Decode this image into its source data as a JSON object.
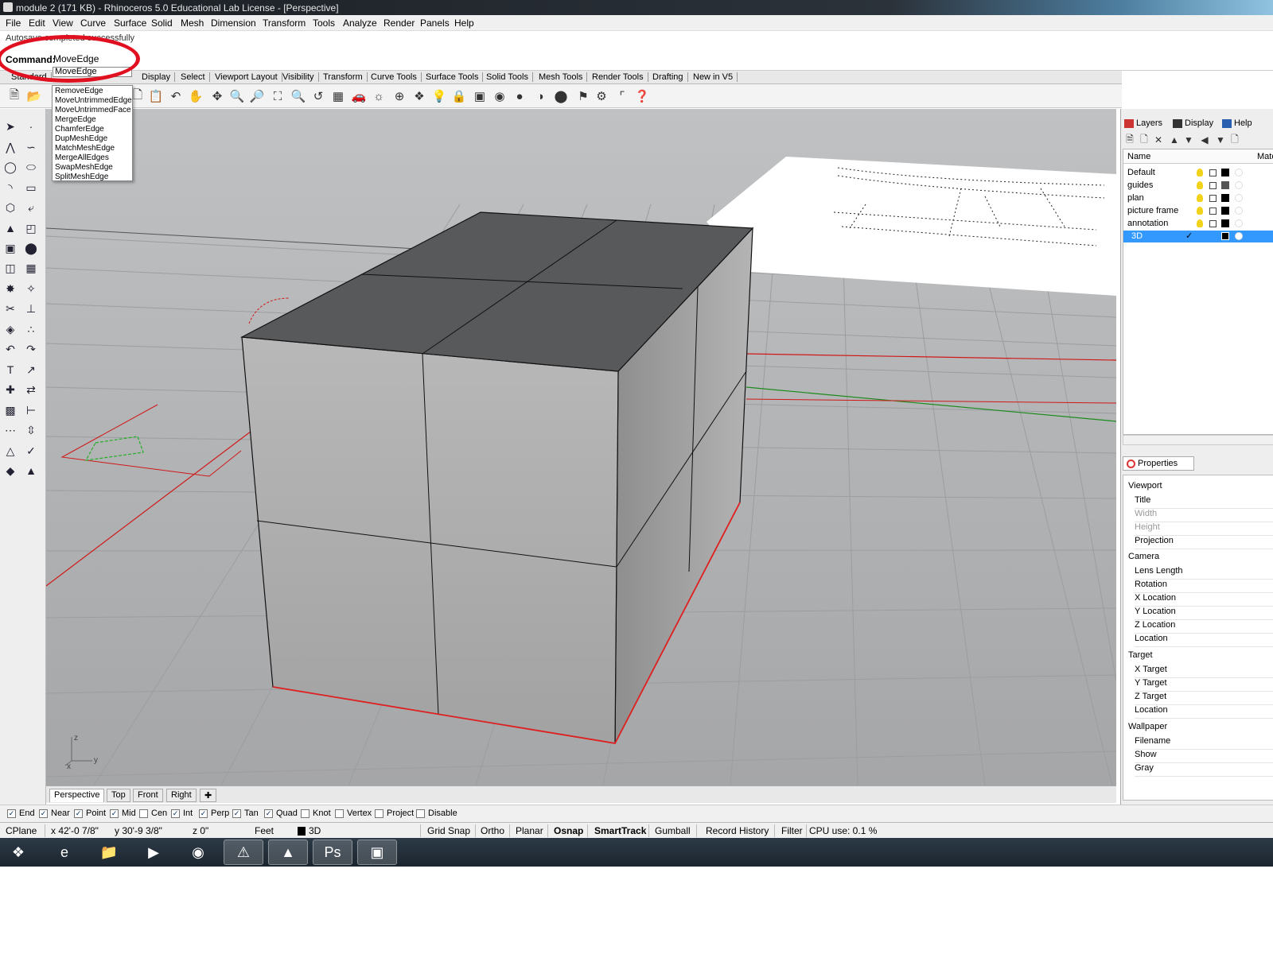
{
  "window": {
    "title": "module 2 (171 KB) - Rhinoceros 5.0 Educational Lab License - [Perspective]"
  },
  "menu": [
    "File",
    "Edit",
    "View",
    "Curve",
    "Surface",
    "Solid",
    "Mesh",
    "Dimension",
    "Transform",
    "Tools",
    "Analyze",
    "Render",
    "Panels",
    "Help"
  ],
  "command": {
    "history": "Autosave completed successfully",
    "label": "Command:",
    "value": "MoveEdge"
  },
  "toolbar_tabs": [
    "Standard",
    "Display",
    "Select",
    "Viewport Layout",
    "Visibility",
    "Transform",
    "Curve Tools",
    "Surface Tools",
    "Solid Tools",
    "Mesh Tools",
    "Render Tools",
    "Drafting",
    "New in V5"
  ],
  "autocomplete": {
    "current": "MoveEdge",
    "items": [
      "RemoveEdge",
      "MoveUntrimmedEdge",
      "MoveUntrimmedFace",
      "MergeEdge",
      "ChamferEdge",
      "DupMeshEdge",
      "MatchMeshEdge",
      "MergeAllEdges",
      "SwapMeshEdge",
      "SplitMeshEdge"
    ]
  },
  "viewport": {
    "name": "Perspective",
    "axis_labels": {
      "z": "z",
      "y": "y",
      "x": "x"
    }
  },
  "viewport_tabs": [
    "Perspective",
    "Top",
    "Front",
    "Right"
  ],
  "osnaps": [
    {
      "label": "End",
      "checked": true
    },
    {
      "label": "Near",
      "checked": true
    },
    {
      "label": "Point",
      "checked": true
    },
    {
      "label": "Mid",
      "checked": true
    },
    {
      "label": "Cen",
      "checked": false
    },
    {
      "label": "Int",
      "checked": true
    },
    {
      "label": "Perp",
      "checked": true
    },
    {
      "label": "Tan",
      "checked": true
    },
    {
      "label": "Quad",
      "checked": true
    },
    {
      "label": "Knot",
      "checked": false
    },
    {
      "label": "Vertex",
      "checked": false
    },
    {
      "label": "Project",
      "checked": false
    },
    {
      "label": "Disable",
      "checked": false
    }
  ],
  "status": {
    "cplane": "CPlane",
    "x": "x 42'-0 7/8\"",
    "y": "y 30'-9 3/8\"",
    "z": "z 0\"",
    "units": "Feet",
    "layer": "3D",
    "grid_snap": "Grid Snap",
    "ortho": "Ortho",
    "planar": "Planar",
    "osnap": "Osnap",
    "smarttrack": "SmartTrack",
    "gumball": "Gumball",
    "record_history": "Record History",
    "filter": "Filter",
    "cpu": "CPU use: 0.1 %"
  },
  "panels": {
    "tabs": [
      "Layers",
      "Display",
      "Help"
    ],
    "layers_header": {
      "name": "Name",
      "material": "Mate"
    },
    "layers": [
      {
        "name": "Default",
        "color": "#000000",
        "selected": false,
        "current": false
      },
      {
        "name": "guides",
        "color": "#555555",
        "selected": false,
        "current": false
      },
      {
        "name": "plan",
        "color": "#000000",
        "selected": false,
        "current": false
      },
      {
        "name": "picture frame",
        "color": "#000000",
        "selected": false,
        "current": false
      },
      {
        "name": "annotation",
        "color": "#000000",
        "selected": false,
        "current": false
      },
      {
        "name": "3D",
        "color": "#000000",
        "selected": true,
        "current": true
      }
    ],
    "properties_tab": "Properties",
    "properties": {
      "viewport_section": "Viewport",
      "viewport_items": [
        "Title",
        "Width",
        "Height",
        "Projection"
      ],
      "camera_section": "Camera",
      "camera_items": [
        "Lens Length",
        "Rotation",
        "X Location",
        "Y Location",
        "Z Location",
        "Location"
      ],
      "target_section": "Target",
      "target_items": [
        "X Target",
        "Y Target",
        "Z Target",
        "Location"
      ],
      "wallpaper_section": "Wallpaper",
      "wallpaper_items": [
        "Filename",
        "Show",
        "Gray"
      ]
    }
  },
  "colors": {
    "accent_highlight": "#e01020",
    "selection": "#3399ff",
    "viewport_bg": "#a8a9ab",
    "box_side": "#a9a9a9",
    "box_top": "#58595b"
  }
}
